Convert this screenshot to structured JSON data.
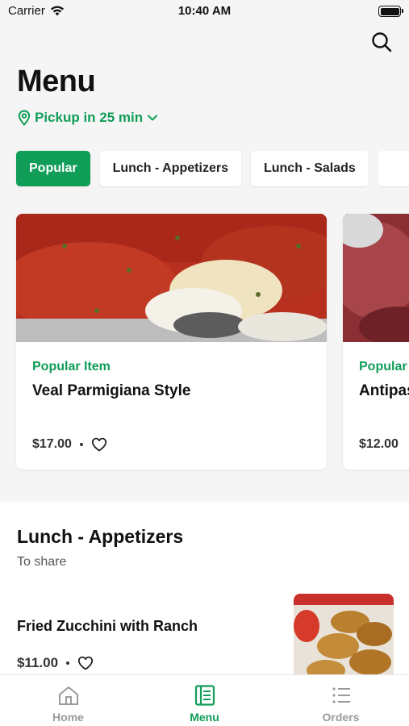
{
  "status_bar": {
    "carrier": "Carrier",
    "time": "10:40 AM"
  },
  "header": {
    "title": "Menu",
    "pickup_label": "Pickup in 25 min"
  },
  "categories": [
    {
      "label": "Popular",
      "active": true
    },
    {
      "label": "Lunch - Appetizers",
      "active": false
    },
    {
      "label": "Lunch -  Salads",
      "active": false
    }
  ],
  "popular_cards": [
    {
      "tag": "Popular Item",
      "name": "Veal Parmigiana Style",
      "price": "$17.00"
    },
    {
      "tag": "Popular Item",
      "name": "Antipasto",
      "price": "$12.00"
    }
  ],
  "section": {
    "title": "Lunch - Appetizers",
    "subtitle": "To share",
    "items": [
      {
        "name": "Fried Zucchini with Ranch",
        "price": "$11.00"
      }
    ]
  },
  "tab_bar": {
    "tabs": [
      {
        "label": "Home",
        "icon": "home-icon",
        "active": false
      },
      {
        "label": "Menu",
        "icon": "menu-book-icon",
        "active": true
      },
      {
        "label": "Orders",
        "icon": "list-icon",
        "active": false
      }
    ]
  },
  "colors": {
    "accent": "#0f9d58",
    "background": "#f5f5f5",
    "inactive_tab": "#9a9a9a"
  }
}
